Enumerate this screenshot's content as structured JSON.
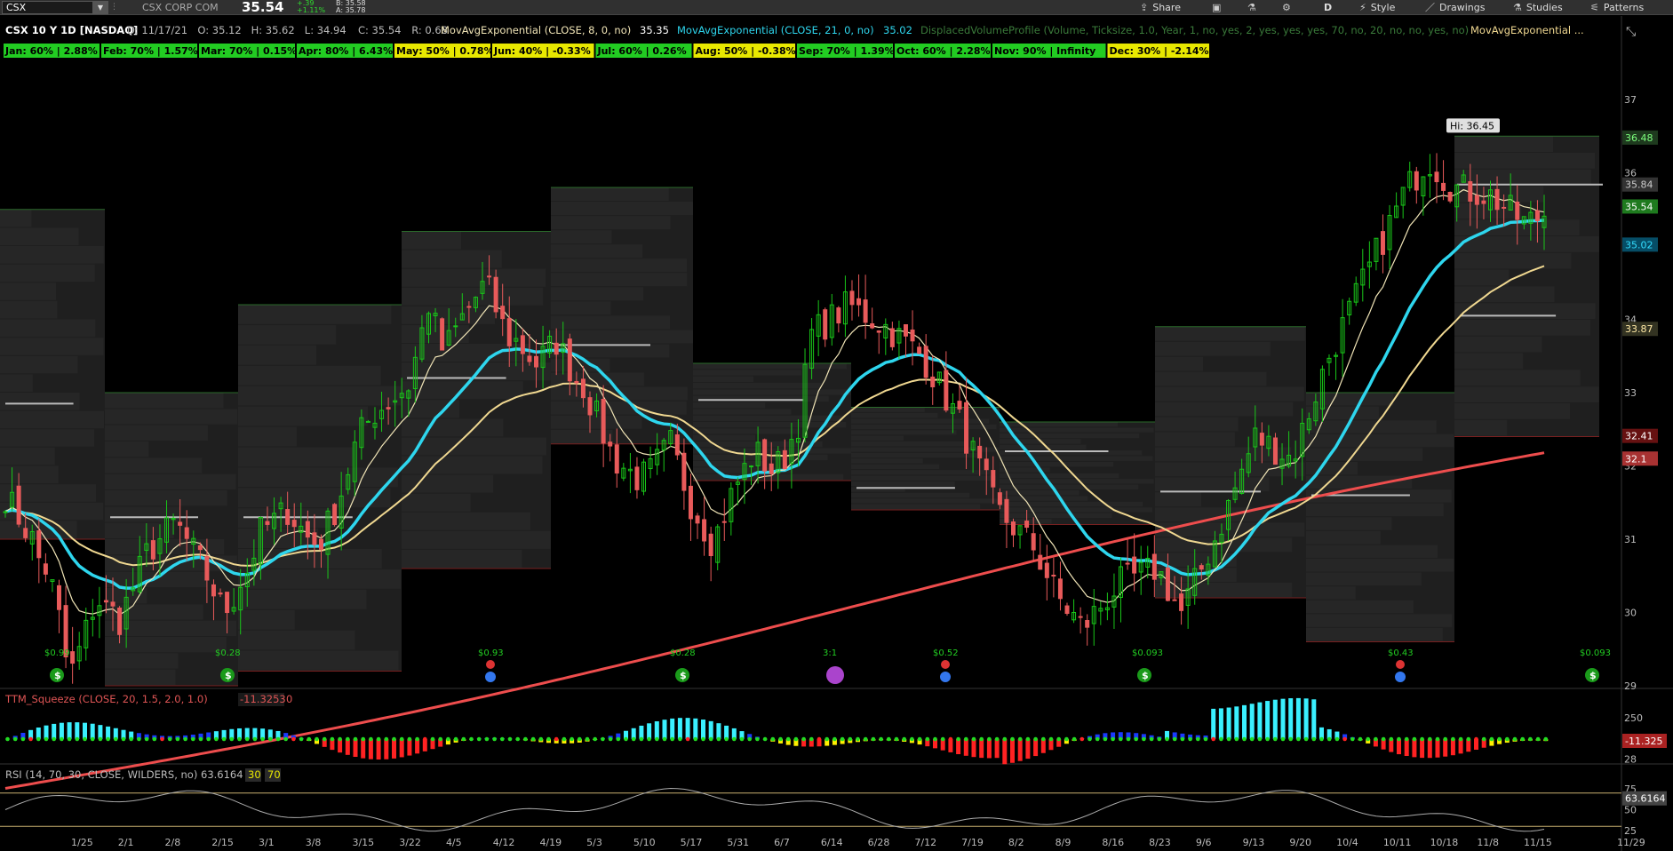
{
  "toolbar": {
    "symbol": "CSX",
    "company": "CSX CORP COM",
    "last": "35.54",
    "change": "+.39",
    "change_pct": "+1.11%",
    "bid": "B: 35.58",
    "ask": "A: 35.78",
    "share": "Share",
    "period": "D",
    "style": "Style",
    "drawings": "Drawings",
    "studies": "Studies",
    "patterns": "Patterns"
  },
  "header": {
    "title": "CSX 10 Y 1D [NASDAQ]",
    "date": "D: 11/17/21",
    "open": "O: 35.12",
    "high": "H: 35.62",
    "low": "L: 34.94",
    "close": "C: 35.54",
    "range": "R: 0.68",
    "study1": "MovAvgExponential (CLOSE, 8, 0, no)",
    "study1_val": "35.35",
    "study2": "MovAvgExponential (CLOSE, 21, 0, no)",
    "study2_val": "35.02",
    "study3": "DisplacedVolumeProfile (Volume, Ticksize, 1.0, Year, 1, no, yes, 2, yes, yes, yes, 70, no, 20, no, no, yes, no)",
    "study4": "MovAvgExponential ..."
  },
  "months": [
    {
      "label": "Jan: 60% | 2.88%",
      "color": "#22cc22"
    },
    {
      "label": "Feb: 70% | 1.57%",
      "color": "#22cc22"
    },
    {
      "label": "Mar: 70% | 0.15%",
      "color": "#22cc22"
    },
    {
      "label": "Apr: 80% | 6.43%",
      "color": "#22cc22"
    },
    {
      "label": "May: 50% | 0.78%",
      "color": "#e8e800"
    },
    {
      "label": "Jun: 40% | -0.33%",
      "color": "#e8e800"
    },
    {
      "label": "Jul: 60% | 0.26%",
      "color": "#22cc22"
    },
    {
      "label": "Aug: 50% | -0.38%",
      "color": "#e8e800"
    },
    {
      "label": "Sep: 70% | 1.39%",
      "color": "#22cc22"
    },
    {
      "label": "Oct: 60% | 2.28%",
      "color": "#22cc22"
    },
    {
      "label": "Nov: 90% | Infinity",
      "color": "#22cc22"
    },
    {
      "label": "Dec: 30% | -2.14%",
      "color": "#e8e800"
    }
  ],
  "price_axis": {
    "ticks": [
      "37",
      "36",
      "35",
      "34",
      "33",
      "32",
      "31",
      "30",
      "29",
      "28"
    ],
    "labels": [
      {
        "text": "36.48",
        "price": 36.48,
        "bg": "#1e3a1e",
        "fg": "#7dff7d"
      },
      {
        "text": "35.84",
        "price": 35.84,
        "bg": "#333333",
        "fg": "#cccccc"
      },
      {
        "text": "35.54",
        "price": 35.54,
        "bg": "#1e7a1e",
        "fg": "#ffffff"
      },
      {
        "text": "35.02",
        "price": 35.02,
        "bg": "#064d66",
        "fg": "#33ddff"
      },
      {
        "text": "33.87",
        "price": 33.87,
        "bg": "#333322",
        "fg": "#ffe9a6"
      },
      {
        "text": "32.41",
        "price": 32.41,
        "bg": "#661111",
        "fg": "#ffffff"
      },
      {
        "text": "32.1",
        "price": 32.1,
        "bg": "#a83232",
        "fg": "#ffffff"
      }
    ],
    "hi_label": "Hi: 36.45",
    "hi_price": 36.45
  },
  "date_axis": [
    "1/25",
    "2/1",
    "2/8",
    "2/15",
    "3/1",
    "3/8",
    "3/15",
    "3/22",
    "4/5",
    "4/12",
    "4/19",
    "5/3",
    "5/10",
    "5/17",
    "5/31",
    "6/7",
    "6/14",
    "6/28",
    "7/12",
    "7/19",
    "8/2",
    "8/9",
    "8/16",
    "8/23",
    "9/6",
    "9/13",
    "9/20",
    "10/4",
    "10/11",
    "10/18",
    "11/8",
    "11/15",
    "11/29"
  ],
  "events": [
    {
      "text": "$0.99",
      "kind": "div"
    },
    {
      "text": "$0.28",
      "kind": "div"
    },
    {
      "text": "$0.93",
      "kind": "earn"
    },
    {
      "text": "$0.28",
      "kind": "div"
    },
    {
      "text": "3:1",
      "kind": "split"
    },
    {
      "text": "$0.52",
      "kind": "earn"
    },
    {
      "text": "$0.093",
      "kind": "div"
    },
    {
      "text": "$0.43",
      "kind": "earn"
    },
    {
      "text": "$0.093",
      "kind": "div"
    }
  ],
  "squeeze": {
    "label": "TTM_Squeeze (CLOSE, 20, 1.5, 2.0, 1.0)",
    "value": "-11.3253",
    "zero": "0",
    "axis_tick": "250",
    "axis_label": "-11.325"
  },
  "rsi": {
    "label": "RSI (14, 70, 30, CLOSE, WILDERS, no)",
    "value": "63.6164",
    "lo": "30",
    "hi": "70",
    "ticks": [
      "75",
      "50",
      "25"
    ],
    "axis_label": "63.6164"
  },
  "colors": {
    "up": "#19c619",
    "down": "#e85a5a",
    "ema8": "#f0e4b6",
    "ema21": "#2ed6ee",
    "ema_slow": "#f0d891",
    "ema_long": "#ee4d4d",
    "accent_green": "#22cc22",
    "accent_yellow": "#e8e800"
  }
}
